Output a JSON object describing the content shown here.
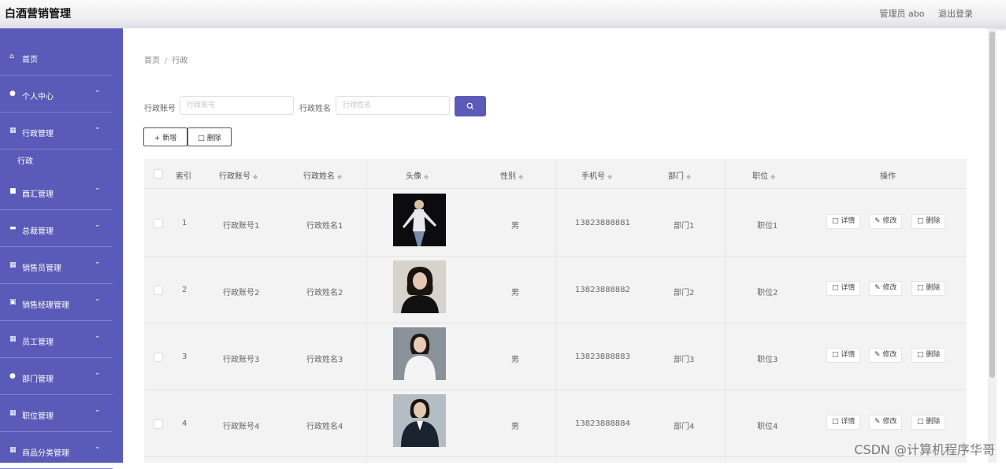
{
  "header": {
    "app_title": "白酒营销管理",
    "user_label": "管理员 abo",
    "logout_label": "退出登录"
  },
  "sidebar": {
    "home": {
      "icon": "home-icon",
      "label": "首页"
    },
    "items": [
      {
        "icon": "person-icon",
        "label": "个人中心"
      },
      {
        "icon": "document-icon",
        "label": "行政管理"
      },
      {
        "icon": "clipboard-icon",
        "label": "酉汇管理"
      },
      {
        "icon": "message-icon",
        "label": "总裁管理"
      },
      {
        "icon": "grid-icon",
        "label": "销售员管理"
      },
      {
        "icon": "chart-icon",
        "label": "销售经理管理"
      },
      {
        "icon": "grid-icon",
        "label": "员工管理"
      },
      {
        "icon": "person-icon",
        "label": "部门管理"
      },
      {
        "icon": "grid-icon",
        "label": "职位管理"
      },
      {
        "icon": "grid-icon",
        "label": "商品分类管理"
      }
    ],
    "submenu": {
      "label": "行政"
    },
    "expand_icon": "chevron-down-icon"
  },
  "breadcrumb": {
    "home": "首页",
    "separator": "/",
    "current": "行政"
  },
  "search": {
    "account_label": "行政账号",
    "account_placeholder": "行政账号",
    "name_label": "行政姓名",
    "name_placeholder": "行政姓名",
    "button_icon": "search-icon"
  },
  "actions": {
    "add_label": "+ 新增",
    "delete_label": "删除"
  },
  "table": {
    "headers": {
      "index": "索引",
      "account": "行政账号",
      "name": "行政姓名",
      "avatar": "头像",
      "gender": "性别",
      "phone": "手机号",
      "department": "部门",
      "position": "职位",
      "operation": "操作"
    },
    "rows": [
      {
        "index": "1",
        "account": "行政账号1",
        "name": "行政姓名1",
        "gender": "男",
        "phone": "13823888881",
        "department": "部门1",
        "position": "职位1"
      },
      {
        "index": "2",
        "account": "行政账号2",
        "name": "行政姓名2",
        "gender": "男",
        "phone": "13823888882",
        "department": "部门2",
        "position": "职位2"
      },
      {
        "index": "3",
        "account": "行政账号3",
        "name": "行政姓名3",
        "gender": "男",
        "phone": "13823888883",
        "department": "部门3",
        "position": "职位3"
      },
      {
        "index": "4",
        "account": "行政账号4",
        "name": "行政姓名4",
        "gender": "男",
        "phone": "13823888884",
        "department": "部门4",
        "position": "职位4"
      }
    ],
    "row_buttons": {
      "detail": "详情",
      "edit": "修改",
      "delete": "删除"
    }
  },
  "watermark": "CSDN @计算机程序华哥",
  "colors": {
    "accent": "#5a5ab8",
    "table_bg": "#f3f3f4"
  }
}
